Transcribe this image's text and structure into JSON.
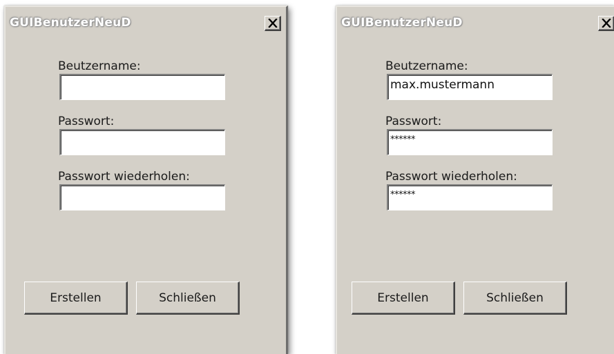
{
  "windows": [
    {
      "title": "GUIBenutzerNeuD",
      "close_glyph": "close-icon",
      "labels": {
        "username": "Beutzername:",
        "password": "Passwort:",
        "password_repeat": "Passwort wiederholen:"
      },
      "fields": {
        "username": "",
        "password": "",
        "password_repeat": ""
      },
      "buttons": {
        "create": "Erstellen",
        "close": "Schließen"
      }
    },
    {
      "title": "GUIBenutzerNeuD",
      "close_glyph": "close-icon",
      "labels": {
        "username": "Beutzername:",
        "password": "Passwort:",
        "password_repeat": "Passwort wiederholen:"
      },
      "fields": {
        "username": "max.mustermann",
        "password": "******",
        "password_repeat": "******"
      },
      "buttons": {
        "create": "Erstellen",
        "close": "Schließen"
      }
    }
  ],
  "colors": {
    "window_bg": "#d4d0c8",
    "field_bg": "#ffffff",
    "title_text": "#ffffff"
  }
}
